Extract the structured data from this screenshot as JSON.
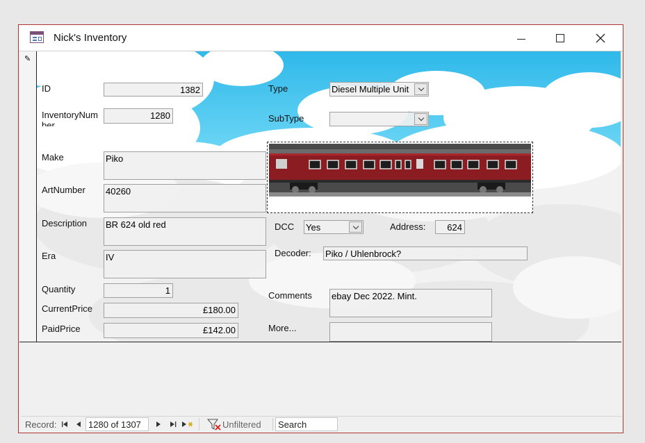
{
  "window": {
    "title": "Nick's Inventory"
  },
  "fields": {
    "id": {
      "label": "ID",
      "value": "1382"
    },
    "inventory_num": {
      "label": "InventoryNum\nber",
      "value": "1280"
    },
    "make": {
      "label": "Make",
      "value": "Piko"
    },
    "art_number": {
      "label": "ArtNumber",
      "value": "40260"
    },
    "description": {
      "label": "Description",
      "value": "BR 624 old red"
    },
    "era": {
      "label": "Era",
      "value": "IV"
    },
    "quantity": {
      "label": "Quantity",
      "value": "1"
    },
    "current_price": {
      "label": "CurrentPrice",
      "value": "£180.00"
    },
    "paid_price": {
      "label": "PaidPrice",
      "value": "£142.00"
    },
    "type": {
      "label": "Type",
      "value": "Diesel Multiple Unit"
    },
    "subtype": {
      "label": "SubType",
      "value": ""
    },
    "dcc": {
      "label": "DCC",
      "value": "Yes"
    },
    "address": {
      "label": "Address:",
      "value": "624"
    },
    "decoder": {
      "label": "Decoder:",
      "value": "Piko / Uhlenbrock?"
    },
    "comments": {
      "label": "Comments",
      "value": "ebay Dec 2022. Mint."
    },
    "more": {
      "label": "More...",
      "value": ""
    }
  },
  "photo": {
    "icon": "train-photo"
  },
  "navigation": {
    "record_label": "Record:",
    "current": "1280 of 1307",
    "filter_label": "Unfiltered",
    "search_placeholder": "Search"
  },
  "colors": {
    "sky": "#3fc6ee",
    "window_border": "#aa3333",
    "train_red": "#8a1c22"
  }
}
